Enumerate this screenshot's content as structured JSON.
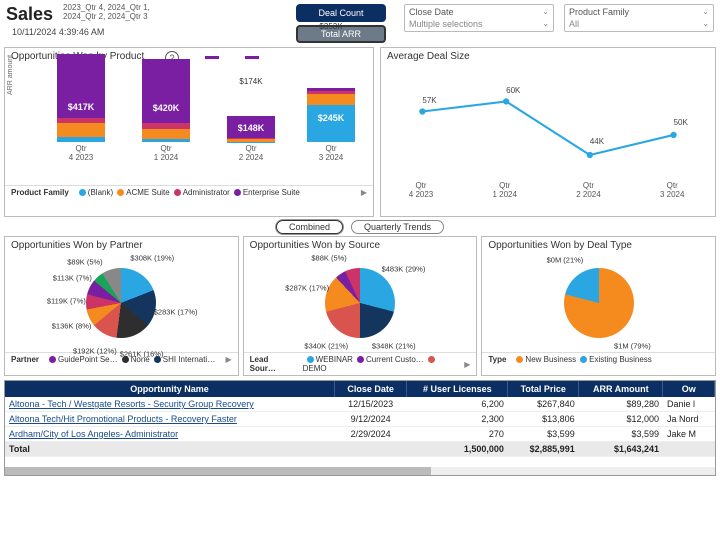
{
  "header": {
    "title": "Sales",
    "subtitle": "2023_Qtr 4, 2024_Qtr 1, 2024_Qtr 2, 2024_Qtr 3",
    "timestamp": "10/11/2024 4:39:46 AM",
    "toggle_deal_count": "Deal Count",
    "toggle_total_arr": "Total ARR"
  },
  "filters": {
    "close_date_label": "Close Date",
    "close_date_value": "Multiple selections",
    "product_family_label": "Product Family",
    "product_family_value": "All"
  },
  "opp_by_product": {
    "title": "Opportunities Won by Product",
    "ylabel": "ARR amount",
    "legend_label": "Product Family",
    "legend": [
      "(Blank)",
      "ACME Suite",
      "Administrator",
      "Enterprise Suite"
    ],
    "legend_colors": [
      "#2aa7e3",
      "#f58b1f",
      "#cc3366",
      "#7b1fa2"
    ]
  },
  "avg_deal": {
    "title": "Average Deal Size"
  },
  "view_tabs": {
    "combined": "Combined",
    "quarterly": "Quarterly Trends"
  },
  "pie_partner": {
    "title": "Opportunities Won by Partner",
    "legend_label": "Partner",
    "legend": [
      "GuidePoint Se…",
      "None",
      "SHI Internati…"
    ]
  },
  "pie_source": {
    "title": "Opportunities Won by Source",
    "legend_label": "Lead Sour…",
    "legend": [
      "WEBINAR",
      "Current Custo…",
      "DEMO"
    ]
  },
  "pie_dealtype": {
    "title": "Opportunities Won by Deal Type",
    "legend_label": "Type",
    "legend": [
      "New Business",
      "Existing Business"
    ]
  },
  "table": {
    "headers": [
      "Opportunity Name",
      "Close Date",
      "# User Licenses",
      "Total Price",
      "ARR Amount",
      "Ow"
    ],
    "rows": [
      {
        "name": "Altoona - Tech / Westgate Resorts - Security Group Recovery",
        "close": "12/15/2023",
        "lic": "6,200",
        "price": "$267,840",
        "arr": "$89,280",
        "owner": "Danie l"
      },
      {
        "name": "Altoona Tech/Hit Promotional Products - Recovery Faster",
        "close": "9/12/2024",
        "lic": "2,300",
        "price": "$13,806",
        "arr": "$12,000",
        "owner": "Ja Nord"
      },
      {
        "name": "Ardham/City of Los Angeles- Administrator",
        "close": "2/29/2024",
        "lic": "270",
        "price": "$3,599",
        "arr": "$3,599",
        "owner": "Jake M"
      }
    ],
    "total_label": "Total",
    "total": {
      "lic": "1,500,000",
      "price": "$2,885,991",
      "arr": "$1,643,241"
    }
  },
  "chart_data": [
    {
      "id": "opportunities_won_by_product",
      "type": "bar",
      "stacked": true,
      "ylabel": "ARR amount",
      "categories": [
        "Qtr 4 2023",
        "Qtr 1 2024",
        "Qtr 2 2024",
        "Qtr 3 2024"
      ],
      "totals_k": [
        573,
        544,
        174,
        353
      ],
      "highlight_value_k": [
        417,
        420,
        148,
        245
      ],
      "highlight_series": [
        "Enterprise Suite",
        "Enterprise Suite",
        "Enterprise Suite",
        "(Blank)"
      ],
      "series": [
        {
          "name": "(Blank)",
          "color": "#2aa7e3",
          "values_k": [
            35,
            20,
            6,
            245
          ]
        },
        {
          "name": "ACME Suite",
          "color": "#f58b1f",
          "values_k": [
            90,
            70,
            15,
            70
          ]
        },
        {
          "name": "Administrator",
          "color": "#cc3366",
          "values_k": [
            31,
            34,
            5,
            18
          ]
        },
        {
          "name": "Enterprise Suite",
          "color": "#7b1fa2",
          "values_k": [
            417,
            420,
            148,
            20
          ]
        }
      ]
    },
    {
      "id": "average_deal_size",
      "type": "line",
      "categories": [
        "Qtr 4 2023",
        "Qtr 1 2024",
        "Qtr 2 2024",
        "Qtr 3 2024"
      ],
      "values_k": [
        57,
        60,
        44,
        50
      ],
      "ylim_k": [
        40,
        65
      ]
    },
    {
      "id": "opportunities_won_by_partner",
      "type": "pie",
      "slices": [
        {
          "label": "$308K",
          "pct": 19,
          "color": "#2aa7e3"
        },
        {
          "label": "$283K",
          "pct": 17,
          "color": "#14365e"
        },
        {
          "label": "$261K",
          "pct": 16,
          "color": "#2e2e2e"
        },
        {
          "label": "$192K",
          "pct": 12,
          "color": "#d9534f"
        },
        {
          "label": "$136K",
          "pct": 8,
          "color": "#f58b1f"
        },
        {
          "label": "$119K",
          "pct": 7,
          "color": "#cc3366"
        },
        {
          "label": "$113K",
          "pct": 7,
          "color": "#7b1fa2"
        },
        {
          "label": "$89K",
          "pct": 5,
          "color": "#18a558"
        },
        {
          "label": "other",
          "pct": 9,
          "color": "#888"
        }
      ]
    },
    {
      "id": "opportunities_won_by_source",
      "type": "pie",
      "slices": [
        {
          "label": "$483K",
          "pct": 29,
          "color": "#2aa7e3"
        },
        {
          "label": "$348K",
          "pct": 21,
          "color": "#14365e"
        },
        {
          "label": "$340K",
          "pct": 21,
          "color": "#d9534f"
        },
        {
          "label": "$287K",
          "pct": 17,
          "color": "#f58b1f"
        },
        {
          "label": "$88K",
          "pct": 5,
          "color": "#7b1fa2"
        },
        {
          "label": "other",
          "pct": 7,
          "color": "#cc3366"
        }
      ]
    },
    {
      "id": "opportunities_won_by_deal_type",
      "type": "pie",
      "slices": [
        {
          "label": "$1M",
          "pct": 79,
          "color": "#f58b1f"
        },
        {
          "label": "$0M",
          "pct": 21,
          "color": "#2aa7e3"
        }
      ]
    }
  ]
}
